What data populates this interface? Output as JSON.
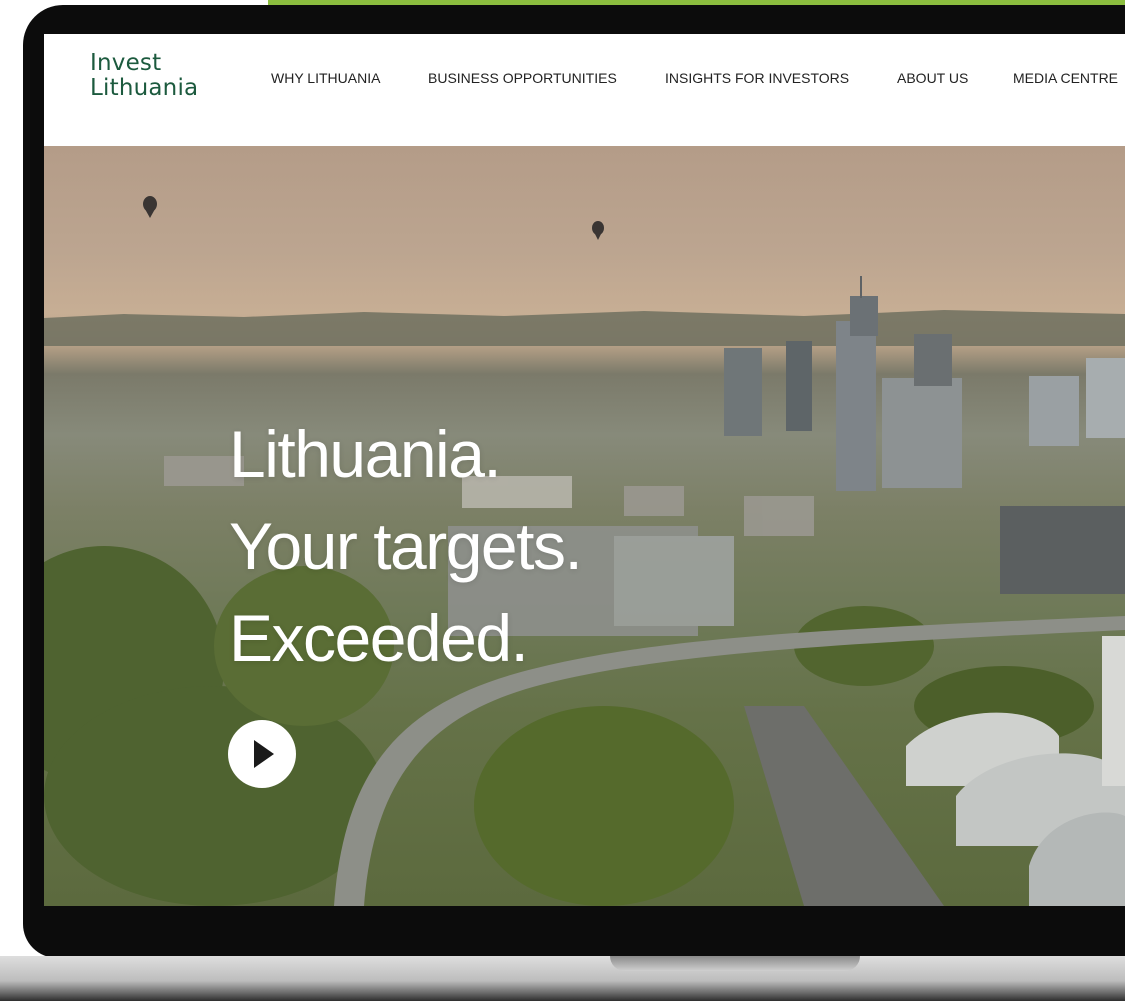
{
  "logo": {
    "line1": "Invest",
    "line2": "Lithuania"
  },
  "nav": {
    "items": [
      {
        "label": "WHY LITHUANIA"
      },
      {
        "label": "BUSINESS OPPORTUNITIES"
      },
      {
        "label": "INSIGHTS FOR INVESTORS"
      },
      {
        "label": "ABOUT US"
      },
      {
        "label": "MEDIA CENTRE"
      }
    ]
  },
  "hero": {
    "headline": [
      "Lithuania.",
      "Your targets.",
      "Exceeded."
    ],
    "play_icon": "play-icon"
  },
  "colors": {
    "brand_green": "#1c5a3e",
    "accent_lime": "#8cbe3f"
  }
}
